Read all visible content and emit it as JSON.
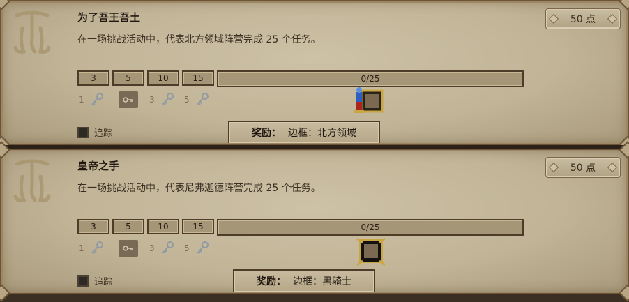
{
  "achievements": [
    {
      "title": "为了吾王吾土",
      "description": "在一场挑战活动中，代表北方领域阵营完成 25 个任务。",
      "points": "50 点",
      "tiers": [
        "3",
        "5",
        "10",
        "15"
      ],
      "progress_text": "0/25",
      "progress_fraction": 0,
      "key_counts": [
        "1",
        "3",
        "5"
      ],
      "track_label": "追踪",
      "reward_label": "奖励：",
      "reward_value": "边框：北方领域",
      "frame_icon": "north-realm-frame-icon"
    },
    {
      "title": "皇帝之手",
      "description": "在一场挑战活动中，代表尼弗迦德阵营完成 25 个任务。",
      "points": "50 点",
      "tiers": [
        "3",
        "5",
        "10",
        "15"
      ],
      "progress_text": "0/25",
      "progress_fraction": 0,
      "key_counts": [
        "1",
        "3",
        "5"
      ],
      "track_label": "追踪",
      "reward_label": "奖励：",
      "reward_value": "边框：黑骑士",
      "frame_icon": "black-knight-frame-icon"
    }
  ],
  "colors": {
    "card_bg": "#c1b497",
    "border_dark": "#4d3c27",
    "text_dark": "#1f1710",
    "accent_blue": "#2e5fbf",
    "accent_red": "#a8261c",
    "gold": "#c9a642"
  }
}
